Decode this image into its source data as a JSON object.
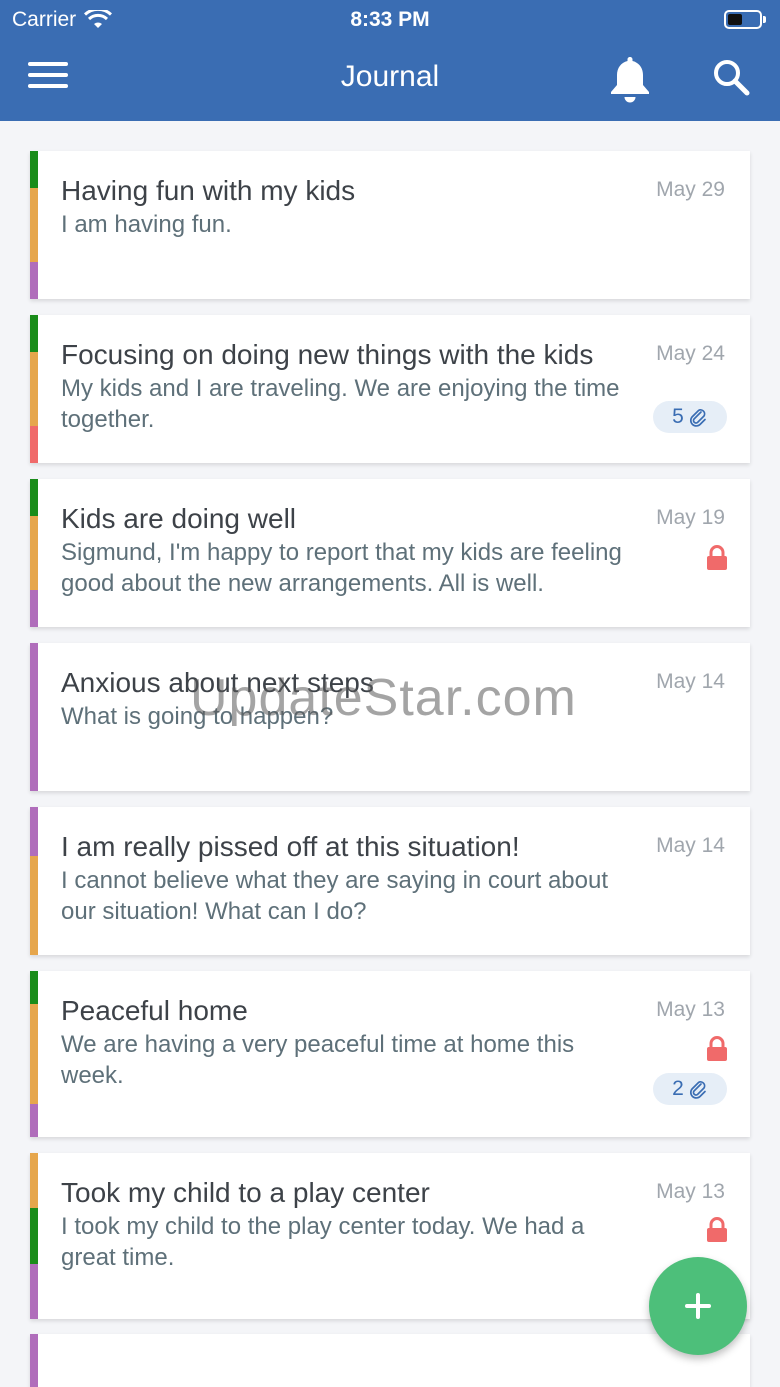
{
  "status_bar": {
    "carrier": "Carrier",
    "time": "8:33 PM"
  },
  "header": {
    "title": "Journal"
  },
  "entries": [
    {
      "title": "Having fun with my kids",
      "preview": "I am having fun.",
      "date": "May 29",
      "locked": false,
      "attachments": "",
      "tags": [
        {
          "color": "#1a8c1a",
          "weight": 1
        },
        {
          "color": "#e6a64c",
          "weight": 2
        },
        {
          "color": "#b06dbb",
          "weight": 1
        }
      ]
    },
    {
      "title": "Focusing on doing new things with the kids",
      "preview": "My kids and I are traveling. We are enjoying the time together.",
      "date": "May 24",
      "locked": false,
      "attachments": "5",
      "tags": [
        {
          "color": "#1a8c1a",
          "weight": 1
        },
        {
          "color": "#e6a64c",
          "weight": 2
        },
        {
          "color": "#f06a6a",
          "weight": 1
        }
      ]
    },
    {
      "title": "Kids are doing well",
      "preview": "Sigmund, I'm happy to report that my kids are feeling good about the new arrangements. All is well.",
      "date": "May 19",
      "locked": true,
      "attachments": "",
      "tags": [
        {
          "color": "#1a8c1a",
          "weight": 1
        },
        {
          "color": "#e6a64c",
          "weight": 2
        },
        {
          "color": "#b06dbb",
          "weight": 1
        }
      ]
    },
    {
      "title": "Anxious about next steps",
      "preview": "What is going to happen?",
      "date": "May 14",
      "locked": false,
      "attachments": "",
      "tags": [
        {
          "color": "#b06dbb",
          "weight": 1
        }
      ]
    },
    {
      "title": "I am really pissed off at this situation!",
      "preview": "I cannot believe what they are saying in court about our situation! What can I do?",
      "date": "May 14",
      "locked": false,
      "attachments": "",
      "tags": [
        {
          "color": "#b06dbb",
          "weight": 1
        },
        {
          "color": "#e6a64c",
          "weight": 2
        }
      ]
    },
    {
      "title": "Peaceful home",
      "preview": "We are having a very peaceful time at home this week.",
      "date": "May 13",
      "locked": true,
      "attachments": "2",
      "tags": [
        {
          "color": "#1a8c1a",
          "weight": 1
        },
        {
          "color": "#e6a64c",
          "weight": 3
        },
        {
          "color": "#b06dbb",
          "weight": 1
        }
      ]
    },
    {
      "title": "Took my child to a play center",
      "preview": "I took my child to the play center today. We had a great time.",
      "date": "May 13",
      "locked": true,
      "attachments": "",
      "tags": [
        {
          "color": "#e6a64c",
          "weight": 1
        },
        {
          "color": "#1a8c1a",
          "weight": 1
        },
        {
          "color": "#b06dbb",
          "weight": 1
        }
      ]
    },
    {
      "title": "",
      "preview": "",
      "date": "",
      "locked": false,
      "attachments": "",
      "tags": [
        {
          "color": "#b06dbb",
          "weight": 1
        }
      ]
    }
  ],
  "watermark": "UpdateStar.com",
  "colors": {
    "header": "#3a6db3",
    "fab": "#4dbf7a",
    "lock": "#f06a6a"
  },
  "icons": [
    "menu-icon",
    "bell-icon",
    "search-icon",
    "lock-icon",
    "paperclip-icon",
    "plus-icon",
    "wifi-icon",
    "battery-icon"
  ]
}
